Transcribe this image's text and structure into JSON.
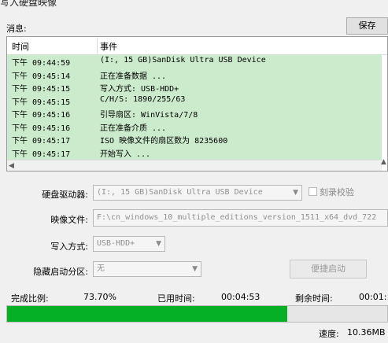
{
  "window": {
    "title": "写入硬盘映像"
  },
  "messages": {
    "label": "消息:",
    "save_button": "保存",
    "columns": {
      "time": "时间",
      "event": "事件"
    },
    "rows": [
      {
        "time": "下午 09:44:59",
        "event": "(I:, 15 GB)SanDisk Ultra USB Device"
      },
      {
        "time": "下午 09:45:14",
        "event": "正在准备数据 ..."
      },
      {
        "time": "下午 09:45:15",
        "event": "写入方式: USB-HDD+"
      },
      {
        "time": "下午 09:45:15",
        "event": "C/H/S: 1890/255/63"
      },
      {
        "time": "下午 09:45:16",
        "event": "引导扇区: WinVista/7/8"
      },
      {
        "time": "下午 09:45:16",
        "event": "正在准备介质 ..."
      },
      {
        "time": "下午 09:45:17",
        "event": "ISO 映像文件的扇区数为 8235600"
      },
      {
        "time": "下午 09:45:17",
        "event": "开始写入 ..."
      }
    ]
  },
  "form": {
    "disk_drive": {
      "label": "硬盘驱动器:",
      "value": "(I:, 15 GB)SanDisk Ultra USB Device"
    },
    "verify": {
      "label": "刻录校验",
      "checked": false
    },
    "image_file": {
      "label": "映像文件:",
      "value": "F:\\cn_windows_10_multiple_editions_version_1511_x64_dvd_722"
    },
    "write_method": {
      "label": "写入方式:",
      "value": "USB-HDD+"
    },
    "hidden_partition": {
      "label": "隐藏启动分区:",
      "value": "无"
    },
    "quick_boot_button": "便捷启动"
  },
  "status": {
    "complete_label": "完成比例:",
    "complete_value": "73.70%",
    "elapsed_label": "已用时间:",
    "elapsed_value": "00:04:53",
    "remaining_label": "剩余时间:",
    "remaining_value": "00:01:",
    "progress_fraction": 0.737,
    "speed_label": "速度:",
    "speed_value": "10.36MB"
  },
  "colors": {
    "log_background": "#ccebcc",
    "progress_fill": "#06b025"
  }
}
